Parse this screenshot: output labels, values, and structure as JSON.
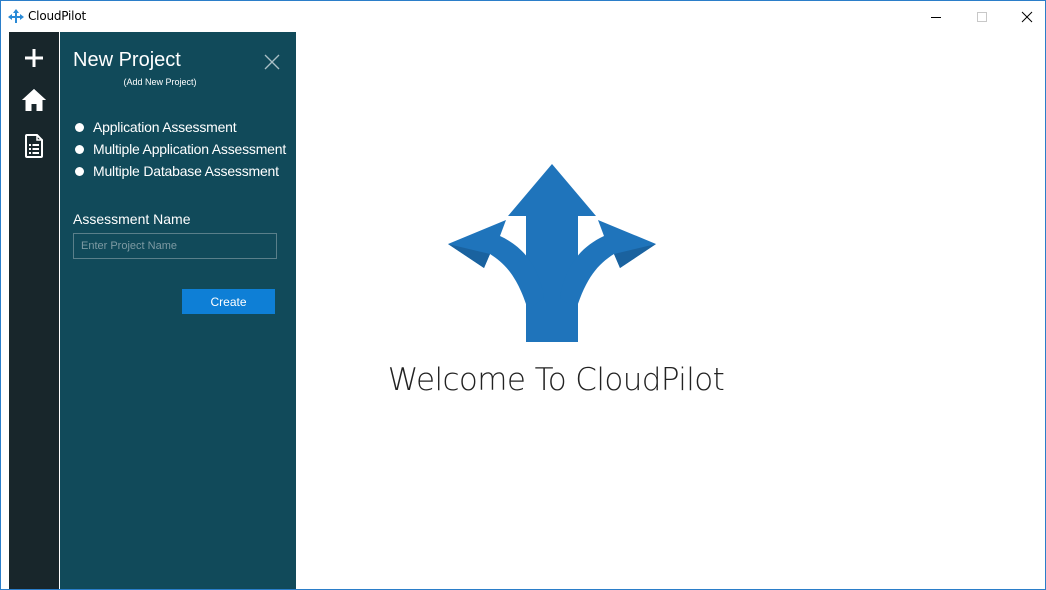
{
  "window": {
    "title": "CloudPilot",
    "accent_color": "#2b7ec9"
  },
  "rail": {
    "background": "#18262b",
    "items": [
      {
        "icon": "plus-icon"
      },
      {
        "icon": "home-icon"
      },
      {
        "icon": "report-icon"
      }
    ]
  },
  "panel": {
    "background": "#114a5a",
    "title": "New Project",
    "subtitle": "(Add New Project)",
    "options": [
      {
        "label": "Application Assessment"
      },
      {
        "label": "Multiple Application Assessment"
      },
      {
        "label": "Multiple Database Assessment"
      }
    ],
    "field_label": "Assessment Name",
    "name_placeholder": "Enter Project Name",
    "name_value": "",
    "create_label": "Create",
    "create_color": "#0e7fd6"
  },
  "main": {
    "welcome": "Welcome To CloudPilot",
    "logo_color": "#1f74bb"
  }
}
